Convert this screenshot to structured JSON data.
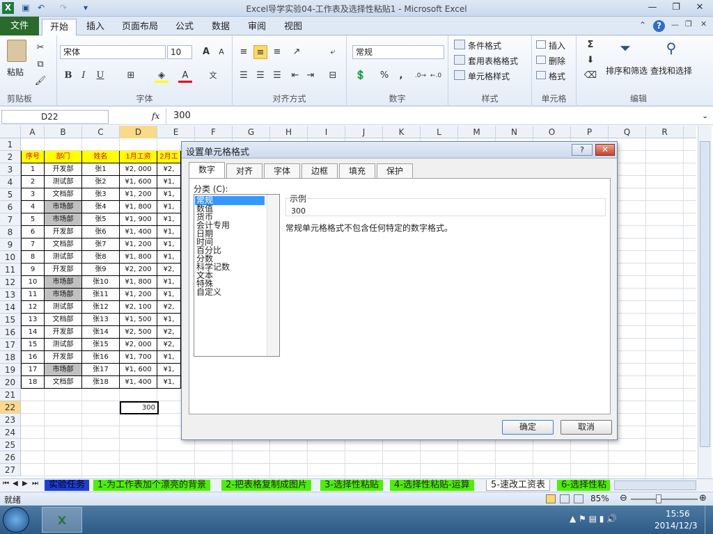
{
  "window": {
    "title": "Excel导学实验04-工作表及选择性粘贴1  -  Microsoft Excel"
  },
  "ribbon_tabs": [
    "文件",
    "开始",
    "插入",
    "页面布局",
    "公式",
    "数据",
    "审阅",
    "视图"
  ],
  "ribbon": {
    "clipboard": {
      "paste": "粘贴",
      "label": "剪贴板"
    },
    "font": {
      "name": "宋体",
      "size": "10",
      "bold": "B",
      "italic": "I",
      "underline": "U",
      "label": "字体"
    },
    "alignment": {
      "label": "对齐方式"
    },
    "number": {
      "format": "常规",
      "percent": "%",
      "comma": ",",
      "label": "数字"
    },
    "styles": {
      "conditional": "条件格式",
      "table": "套用表格格式",
      "cell": "单元格样式",
      "label": "样式"
    },
    "cells": {
      "insert": "插入",
      "delete": "删除",
      "format": "格式",
      "label": "单元格"
    },
    "editing": {
      "sort": "排序和筛选",
      "find": "查找和选择",
      "label": "编辑",
      "sigma": "Σ"
    }
  },
  "formula_bar": {
    "name_box": "D22",
    "fx": "fx",
    "value": "300"
  },
  "columns": [
    "A",
    "B",
    "C",
    "D",
    "E",
    "F",
    "G",
    "H",
    "I",
    "J",
    "K",
    "L",
    "M",
    "N",
    "O",
    "P",
    "Q",
    "R"
  ],
  "rows": [
    "1",
    "2",
    "3",
    "4",
    "5",
    "6",
    "7",
    "8",
    "9",
    "10",
    "11",
    "12",
    "13",
    "14",
    "15",
    "16",
    "17",
    "18",
    "19",
    "20",
    "21",
    "22",
    "23",
    "24",
    "25",
    "26",
    "27"
  ],
  "table": {
    "headers": [
      "序号",
      "部门",
      "姓名",
      "1月工资",
      "2月工"
    ],
    "data": [
      [
        "1",
        "开发部",
        "张1",
        "¥2, 000",
        "¥2,"
      ],
      [
        "2",
        "测试部",
        "张2",
        "¥1, 600",
        "¥1,"
      ],
      [
        "3",
        "文档部",
        "张3",
        "¥1, 200",
        "¥1,"
      ],
      [
        "4",
        "市场部",
        "张4",
        "¥1, 800",
        "¥1,"
      ],
      [
        "5",
        "市场部",
        "张5",
        "¥1, 900",
        "¥1,"
      ],
      [
        "6",
        "开发部",
        "张6",
        "¥1, 400",
        "¥1,"
      ],
      [
        "7",
        "文档部",
        "张7",
        "¥1, 200",
        "¥1,"
      ],
      [
        "8",
        "测试部",
        "张8",
        "¥1, 800",
        "¥1,"
      ],
      [
        "9",
        "开发部",
        "张9",
        "¥2, 200",
        "¥2,"
      ],
      [
        "10",
        "市场部",
        "张10",
        "¥1, 800",
        "¥1,"
      ],
      [
        "11",
        "市场部",
        "张11",
        "¥1, 200",
        "¥1,"
      ],
      [
        "12",
        "测试部",
        "张12",
        "¥2, 100",
        "¥2,"
      ],
      [
        "13",
        "文档部",
        "张13",
        "¥1, 500",
        "¥1,"
      ],
      [
        "14",
        "开发部",
        "张14",
        "¥2, 500",
        "¥2,"
      ],
      [
        "15",
        "测试部",
        "张15",
        "¥2, 000",
        "¥2,"
      ],
      [
        "16",
        "开发部",
        "张16",
        "¥1, 700",
        "¥1,"
      ],
      [
        "17",
        "市场部",
        "张17",
        "¥1, 600",
        "¥1,"
      ],
      [
        "18",
        "文档部",
        "张18",
        "¥1, 400",
        "¥1,"
      ]
    ],
    "d22_value": "300"
  },
  "dialog": {
    "title": "设置单元格格式",
    "tabs": [
      "数字",
      "对齐",
      "字体",
      "边框",
      "填充",
      "保护"
    ],
    "category_label": "分类 (C):",
    "categories": [
      "常规",
      "数值",
      "货币",
      "会计专用",
      "日期",
      "时间",
      "百分比",
      "分数",
      "科学记数",
      "文本",
      "特殊",
      "自定义"
    ],
    "sample_label": "示例",
    "sample_value": "300",
    "description": "常规单元格格式不包含任何特定的数字格式。",
    "ok": "确定",
    "cancel": "取消",
    "help": "?"
  },
  "sheet_tabs": [
    "实验任务",
    "1-为工作表加个漂亮的背景",
    "2-把表格复制成图片",
    "3-选择性粘贴",
    "4-选择性粘贴-运算",
    "5-速改工资表",
    "6-选择性粘"
  ],
  "status": {
    "ready": "就绪",
    "zoom": "85%"
  },
  "taskbar": {
    "time": "15:56",
    "date": "2014/12/3"
  }
}
